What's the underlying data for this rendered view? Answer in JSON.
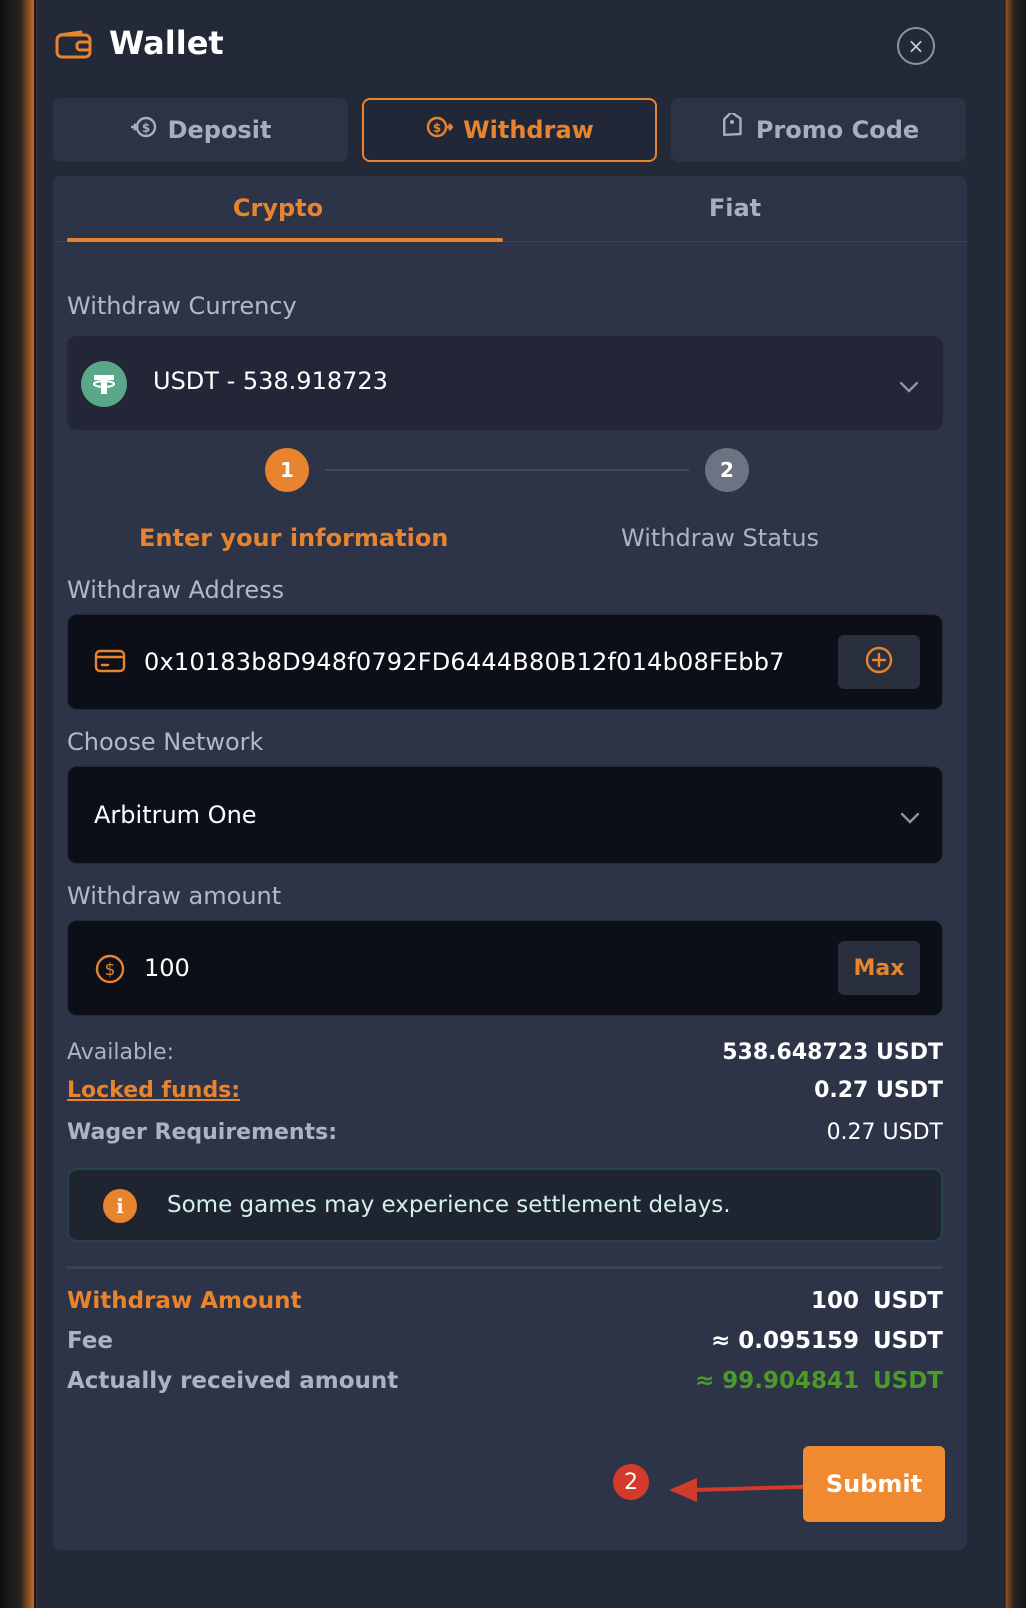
{
  "header": {
    "title": "Wallet",
    "close_label": "×"
  },
  "tabs": [
    {
      "label": "Deposit",
      "active": false
    },
    {
      "label": "Withdraw",
      "active": true
    },
    {
      "label": "Promo Code",
      "active": false
    }
  ],
  "subtabs": {
    "crypto": "Crypto",
    "fiat": "Fiat"
  },
  "currency": {
    "label": "Withdraw Currency",
    "value": "USDT - 538.918723"
  },
  "stepper": {
    "step1_number": "1",
    "step1_label": "Enter your information",
    "step2_number": "2",
    "step2_label": "Withdraw Status"
  },
  "address": {
    "label": "Withdraw Address",
    "value": "0x10183b8D948f0792FD6444B80B12f014b08FEbb7"
  },
  "network": {
    "label": "Choose Network",
    "value": "Arbitrum One"
  },
  "amount": {
    "label": "Withdraw amount",
    "value": "100",
    "max_label": "Max"
  },
  "balances": {
    "available_label": "Available:",
    "available_value": "538.648723 USDT",
    "locked_label": "Locked funds:",
    "locked_value": "0.27 USDT",
    "wager_label": "Wager Requirements:",
    "wager_value": "0.27 USDT"
  },
  "notice": {
    "text": "Some games may experience settlement delays.",
    "icon_char": "i"
  },
  "summary": {
    "withdraw_amount_label": "Withdraw Amount",
    "withdraw_amount_value": "100",
    "fee_label": "Fee",
    "fee_value": "≈ 0.095159",
    "received_label": "Actually received amount",
    "received_value": "≈ 99.904841",
    "currency": "USDT"
  },
  "submit_label": "Submit",
  "annotation": {
    "badge": "2"
  },
  "colors": {
    "accent": "#e8832e",
    "panel": "#2e3447",
    "input_dark": "#0c0f17",
    "success": "#4c9a2a",
    "tether": "#5aa78a"
  }
}
